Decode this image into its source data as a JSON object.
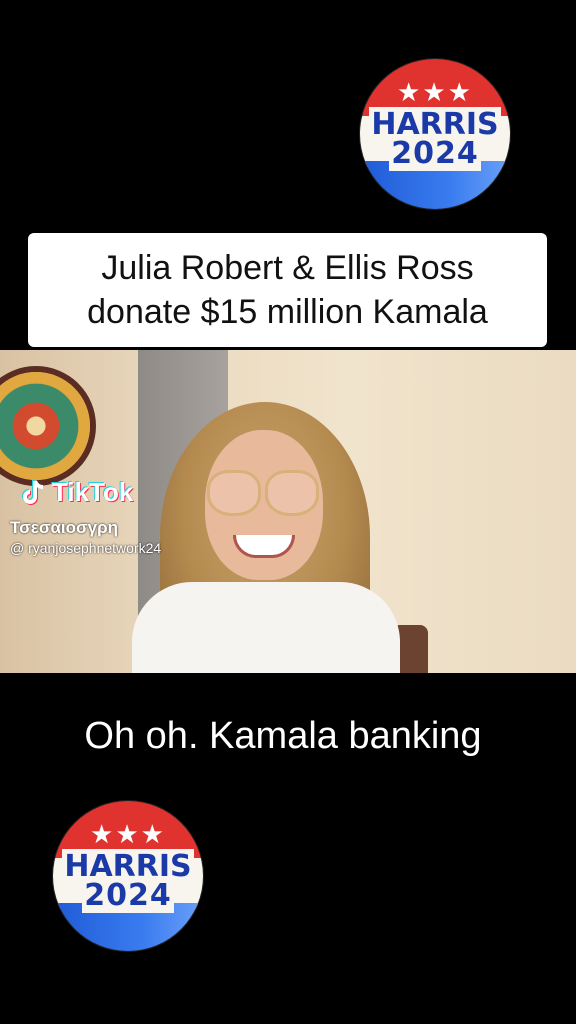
{
  "badge_top": {
    "stars": "★★★",
    "line1": "HARRIS",
    "line2": "2024"
  },
  "headline": {
    "line1": "Julia Robert & Ellis Ross",
    "line2": "donate $15 million Kamala"
  },
  "watermark": {
    "brand": "TikTok",
    "overlap_text": "Τσεσαιοσγρη",
    "handle": "@ ryanjosephnetwork24"
  },
  "caption": "Oh oh.  Kamala banking",
  "badge_bottom": {
    "stars": "★★★",
    "line1": "HARRIS",
    "line2": "2024"
  },
  "colors": {
    "badge_red": "#e0332f",
    "badge_blue": "#1f5bd6",
    "badge_text": "#1b3aa8"
  }
}
